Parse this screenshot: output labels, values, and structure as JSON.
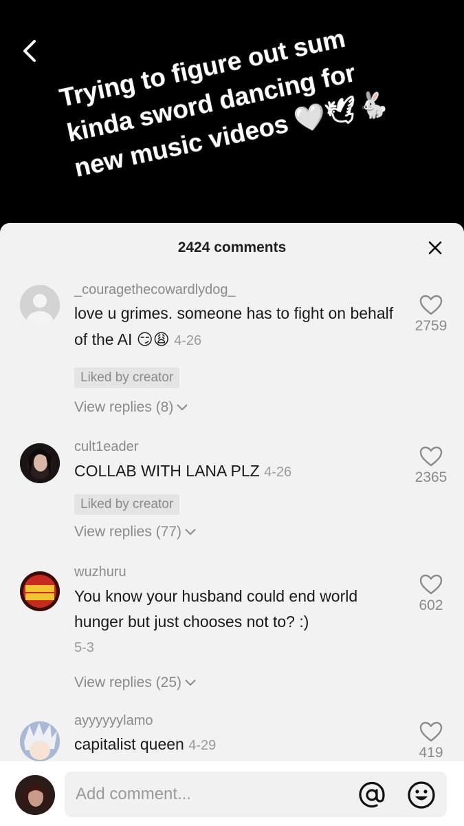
{
  "video": {
    "caption_lines": [
      "Trying to figure out sum",
      "kinda sword dancing for",
      "new music videos 🤍🕊🐇"
    ]
  },
  "sheet": {
    "title": "2424 comments"
  },
  "comments": [
    {
      "username": "_couragethecowardlydog_",
      "text": "love u grimes. someone has to fight on behalf of the AI 😏😩",
      "date": "4-26",
      "liked_by_creator": "Liked by creator",
      "view_replies": "View replies (8)",
      "likes": "2759"
    },
    {
      "username": "cult1eader",
      "text": "COLLAB WITH LANA PLZ",
      "date": "4-26",
      "liked_by_creator": "Liked by creator",
      "view_replies": "View replies (77)",
      "likes": "2365"
    },
    {
      "username": "wuzhuru",
      "avatar_text": "WE DA PEOPLE",
      "text": "You know your husband could end world hunger but just chooses not to? :)",
      "date": "5-3",
      "view_replies": "View replies (25)",
      "likes": "602"
    },
    {
      "username": "ayyyyyylamo",
      "text": "capitalist queen",
      "date": "4-29",
      "likes": "419"
    }
  ],
  "composer": {
    "placeholder": "Add comment..."
  },
  "colors": {
    "sheet_bg": "#f2f2f2",
    "muted_text": "#8a8a8a",
    "primary_text": "#1a1a1a"
  }
}
